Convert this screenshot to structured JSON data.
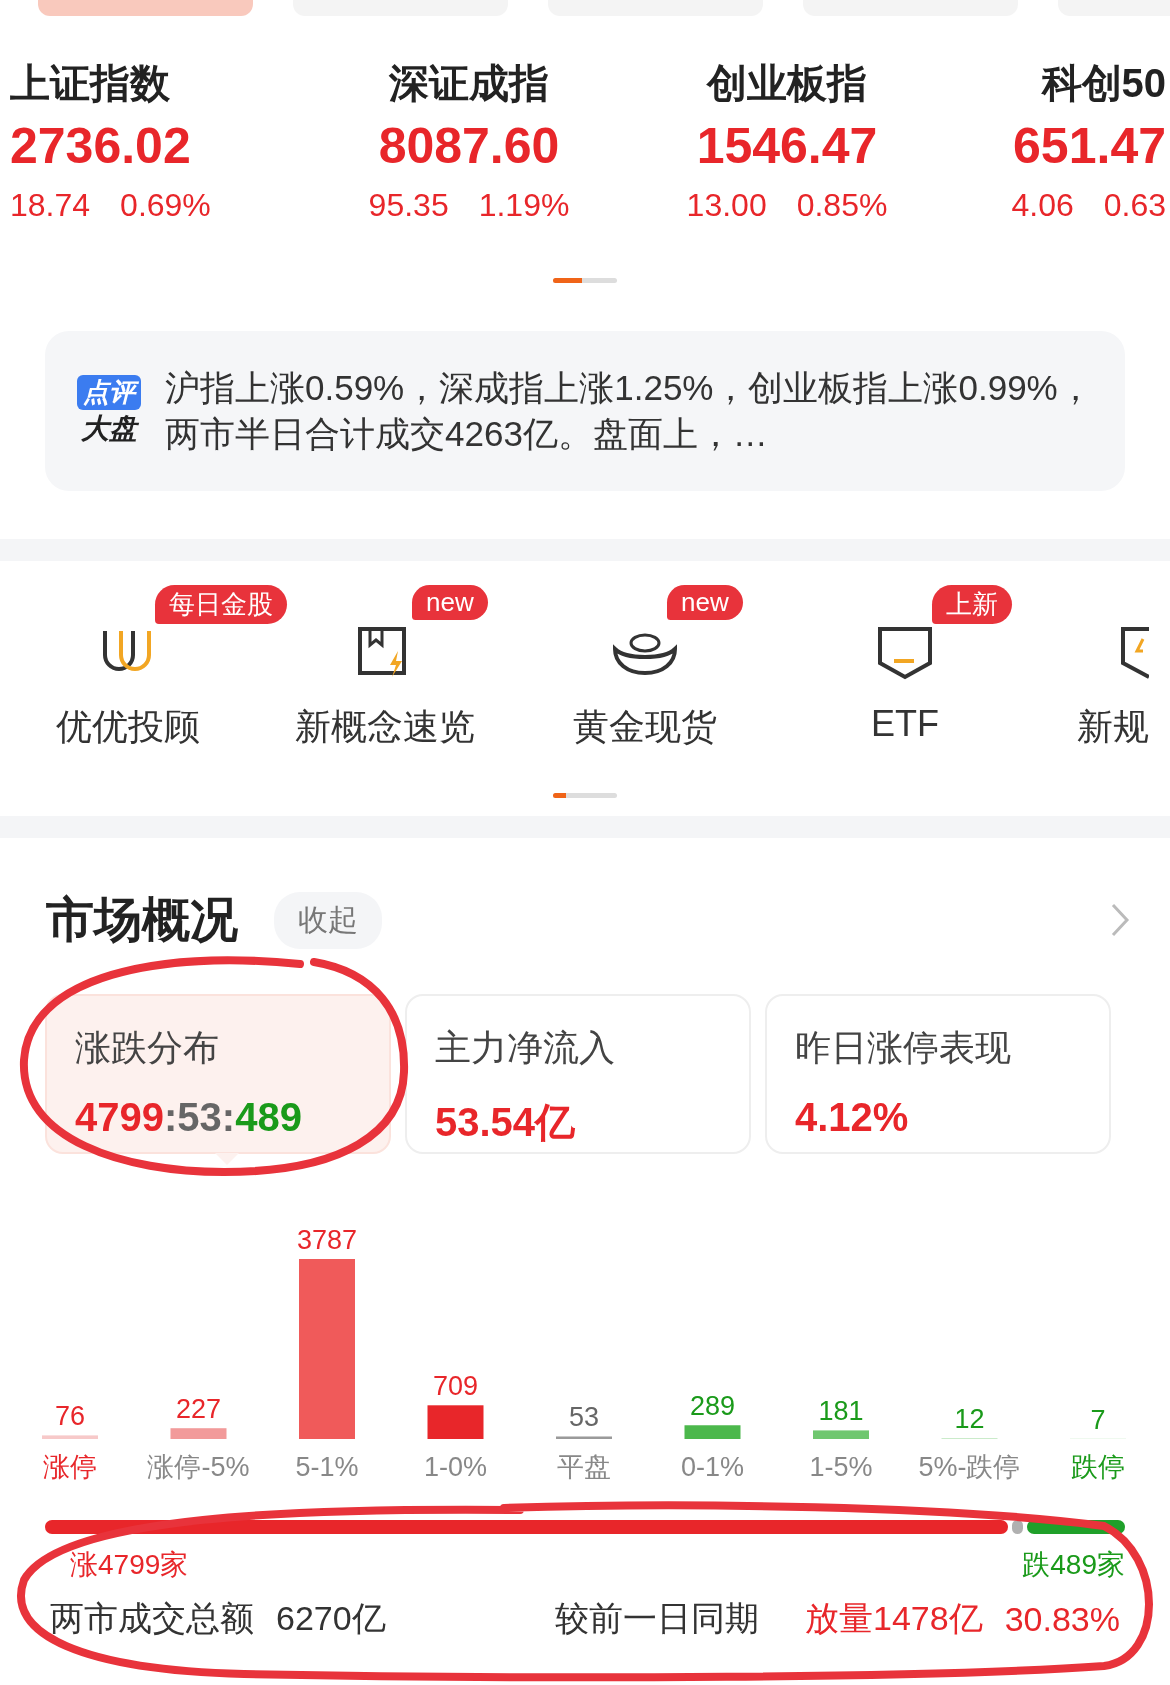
{
  "top_tabs": [
    {
      "selected": true
    },
    {
      "selected": false
    },
    {
      "selected": false
    },
    {
      "selected": false
    },
    {
      "selected": false
    }
  ],
  "indices": [
    {
      "name": "上证指数",
      "value": "2736.02",
      "change": "18.74",
      "percent": "0.69%"
    },
    {
      "name": "深证成指",
      "value": "8087.60",
      "change": "95.35",
      "percent": "1.19%"
    },
    {
      "name": "创业板指",
      "value": "1546.47",
      "change": "13.00",
      "percent": "0.85%"
    },
    {
      "name": "科创50",
      "value": "651.47",
      "change": "4.06",
      "percent": "0.63"
    }
  ],
  "indices_pager": {
    "level": 0.45
  },
  "commentary": {
    "badge_top": "点评",
    "badge_bottom": "大盘",
    "text": "沪指上涨0.59%，深成指上涨1.25%，创业板指上涨0.99%，两市半日合计成交4263亿。盘面上，…"
  },
  "shortcuts": [
    {
      "kind": "advisor",
      "label": "优优投顾",
      "badge": "每日金股"
    },
    {
      "kind": "concept",
      "label": "新概念速览",
      "badge": "new"
    },
    {
      "kind": "gold",
      "label": "黄金现货",
      "badge": "new"
    },
    {
      "kind": "etf",
      "label": "ETF",
      "badge": "上新"
    },
    {
      "kind": "shield",
      "label": "新规"
    }
  ],
  "shortcuts_pager": {
    "level": 0.2
  },
  "market": {
    "title": "市场概况",
    "collapse": "收起",
    "cards": [
      {
        "title": "涨跌分布",
        "kind": "ratio",
        "up": "4799",
        "separator": ":",
        "flat": "53",
        "down": "489",
        "selected": true
      },
      {
        "title": "主力净流入",
        "kind": "value",
        "value": "53.54亿",
        "selected": false
      },
      {
        "title": "昨日涨停表现",
        "kind": "value",
        "value": "4.12%",
        "selected": false
      }
    ],
    "chart_data": {
      "type": "bar",
      "categories": [
        "涨停",
        "涨停-5%",
        "5-1%",
        "1-0%",
        "平盘",
        "0-1%",
        "1-5%",
        "5%-跌停",
        "跌停"
      ],
      "values": [
        76,
        227,
        3787,
        709,
        53,
        289,
        181,
        12,
        7
      ],
      "colors": [
        "#f7c9c9",
        "#f29a9a",
        "#f05a5a",
        "#e8262a",
        "#9a9a9a",
        "#4cb84c",
        "#6fc76f",
        "#a3dca3",
        "#cdeccd"
      ],
      "data_labels": true
    },
    "up_count": "涨4799家",
    "down_count": "跌489家",
    "turnover_label": "两市成交总额",
    "turnover": "6270亿",
    "compare_label": "较前一日同期",
    "compare_value": "放量1478亿",
    "compare_percent": "30.83%"
  }
}
